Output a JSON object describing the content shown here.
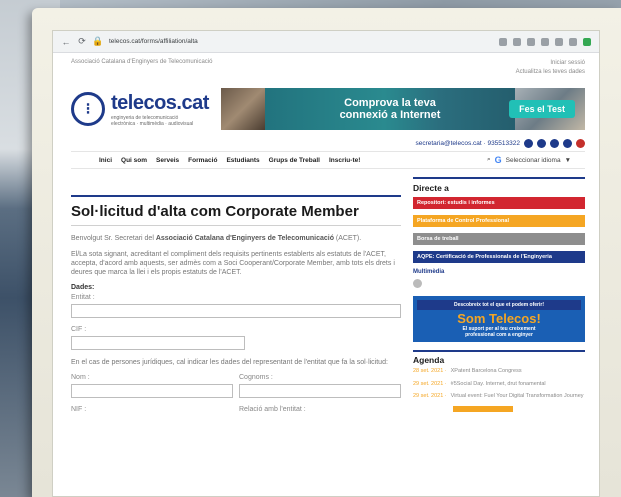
{
  "browser": {
    "url": "telecos.cat/forms/affiliation/alta"
  },
  "site": {
    "association_name": "Associació Catalana d'Enginyers de Telecomunicació",
    "top_right": [
      "Iniciar sessió",
      "Actualitza les teves dades"
    ],
    "logo_name": "telecos.cat",
    "logo_tagline": [
      "enginyeria de telecomunicació",
      "electrònica · multimèdia · audiovisual"
    ],
    "ad": {
      "text_line1": "Comprova la teva",
      "text_line2": "connexió a Internet",
      "button": "Fes el Test"
    },
    "contact": "secretaria@telecos.cat · 935513322",
    "nav": [
      "Inici",
      "Qui som",
      "Serveis",
      "Formació",
      "Estudiants",
      "Grups de Treball",
      "Inscriu-te!"
    ],
    "language_select": "Seleccionar idioma",
    "language_select_arrow": "▼"
  },
  "form": {
    "title": "Sol·licitud d'alta com Corporate Member",
    "greeting_prefix": "Benvolgut Sr. Secretari del ",
    "greeting_bold": "Associació Catalana d'Enginyers de Telecomunicació",
    "greeting_suffix": " (ACET).",
    "paragraph": "El/La sota signant, acreditant el compliment dels requisits pertinents establerts als estatuts de l'ACET, accepta, d'acord amb aquests, ser admès com a Soci Cooperant/Corporate Member, amb tots els drets i deures que marca la llei i els propis estatuts de l'ACET.",
    "section_label": "Dades:",
    "fields": {
      "entitat": "Entitat :",
      "cif": "CIF :",
      "representative_note": "En el cas de persones jurídiques, cal indicar les dades del representant de l'entitat que fa la sol·licitud:",
      "nom": "Nom :",
      "cognoms": "Cognoms :",
      "nif": "NIF :",
      "relacio": "Relació amb l'entitat :"
    }
  },
  "sidebar": {
    "heading": "Directe a",
    "buttons": [
      {
        "label": "Repositori: estudis i informes",
        "color": "#d22630"
      },
      {
        "label": "Plataforma de Control Professional",
        "color": "#f5a623"
      },
      {
        "label": "Borsa de treball",
        "color": "#8e8e8e"
      },
      {
        "label": "AQPE: Certificació de Professionals de l'Enginyeria",
        "color": "#1e3a8a"
      }
    ],
    "multimedia_link": "Multimèdia",
    "promo": {
      "top": "Descobreix tot el que et podem oferir!",
      "big": "Som Telecos!",
      "sub1": "El suport per al teu creixement",
      "sub2": "professional com a enginyer"
    },
    "agenda_heading": "Agenda",
    "agenda": [
      {
        "date": "28 set. 2021 ·",
        "text": "XPatent Barcelona Congress"
      },
      {
        "date": "29 set. 2021 ·",
        "text": "#5Social Day. Internet, drut fonamental"
      },
      {
        "date": "29 set. 2021 ·",
        "text": "Virtual event: Fuel Your Digital Transformation Journey"
      }
    ]
  },
  "colors": {
    "brand_navy": "#1e3a8a",
    "accent_orange": "#f5a623",
    "accent_red": "#d22630",
    "ad_button": "#21c0b6"
  }
}
